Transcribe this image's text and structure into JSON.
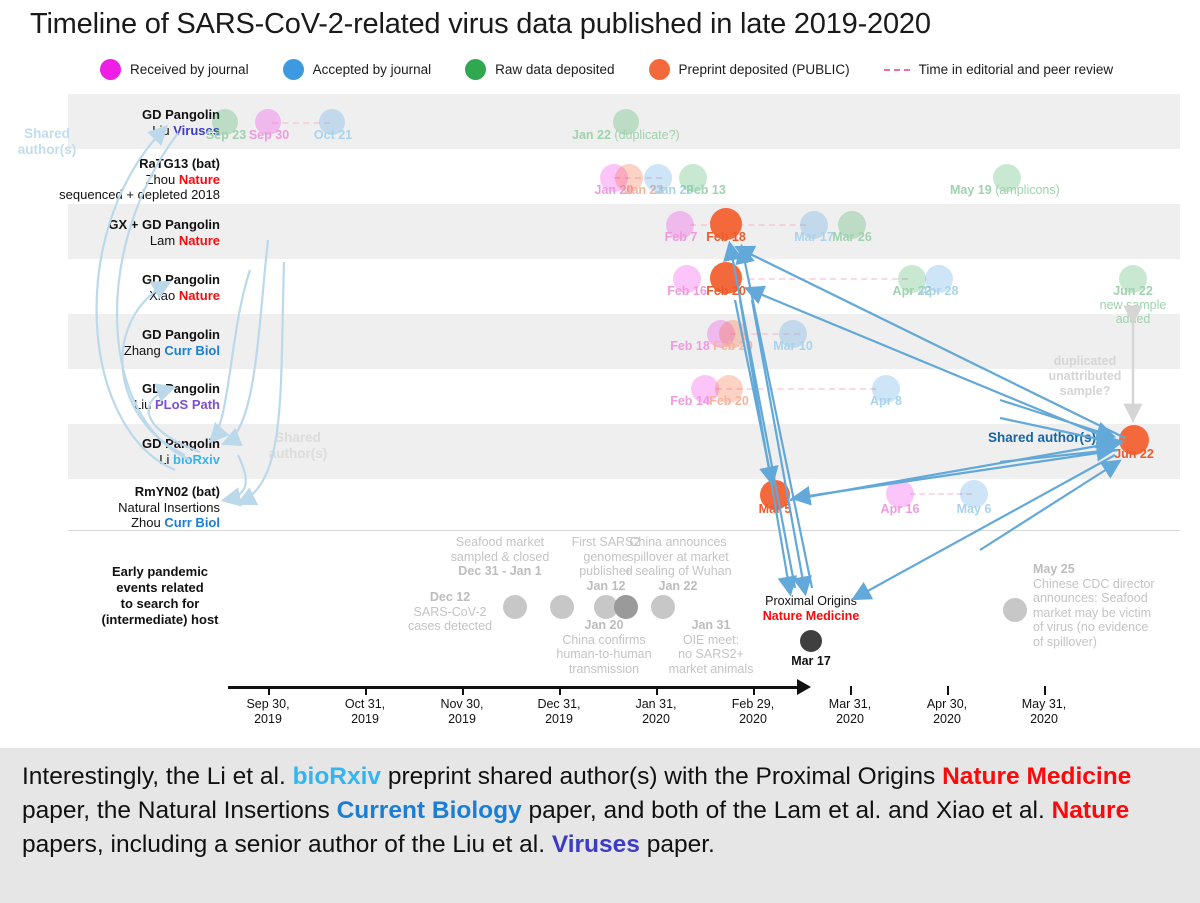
{
  "title": "Timeline of SARS-CoV-2-related virus data published in late 2019-2020",
  "legend": {
    "items": [
      {
        "label": "Received by journal",
        "color": "#ee1ee6",
        "icon": "dot-icon"
      },
      {
        "label": "Accepted by journal",
        "color": "#3d9ae0",
        "icon": "dot-icon"
      },
      {
        "label": "Raw data deposited",
        "color": "#2fa84f",
        "icon": "dot-icon"
      },
      {
        "label": "Preprint deposited (PUBLIC)",
        "color": "#f4693c",
        "icon": "dot-icon"
      },
      {
        "label": "Time in editorial and peer review",
        "color": "#f06fa8",
        "icon": "dashed-line-icon"
      }
    ]
  },
  "annotations": {
    "shared_left": "Shared\nauthor(s)",
    "shared_left_line1": "Shared",
    "shared_left_line2": "author(s)",
    "shared_mid_line1": "Shared",
    "shared_mid_line2": "author(s)",
    "shared_right": "Shared author(s)",
    "duplicated_line1": "duplicated",
    "duplicated_line2": "unattributed",
    "duplicated_line3": "sample?",
    "jun22_note_line1": "new sample",
    "jun22_note_line2": "added"
  },
  "section_label": {
    "line1": "Early pandemic",
    "line2": "events related",
    "line3": "to search for",
    "line4": "(intermediate) host"
  },
  "proximal": {
    "line1": "Proximal Origins",
    "line2": "Nature Medicine",
    "date": "Mar 17"
  },
  "rows": [
    {
      "id": "liu-viruses",
      "label_line1": "GD Pangolin",
      "label_line2_author": "Liu",
      "label_line2_journal": "Viruses",
      "journal_class": "j-viruses",
      "events": [
        {
          "date": "Sep 23",
          "type": "raw",
          "note": ""
        },
        {
          "date": "Sep 30",
          "type": "received",
          "note": ""
        },
        {
          "date": "Oct 21",
          "type": "accepted",
          "note": ""
        },
        {
          "date": "Jan 22",
          "type": "raw",
          "note": "(duplicate?)"
        }
      ]
    },
    {
      "id": "ratg13-zhou-nature",
      "label_line1": "RaTG13 (bat)",
      "label_line2_author": "Zhou",
      "label_line2_journal": "Nature",
      "label_line3": "sequenced + depleted 2018",
      "journal_class": "j-nature",
      "events": [
        {
          "date": "Jan 20",
          "type": "received",
          "note": ""
        },
        {
          "date": "Jan 23",
          "type": "preprint",
          "note": ""
        },
        {
          "date": "Jan 29",
          "type": "accepted",
          "note": ""
        },
        {
          "date": "Feb 13",
          "type": "raw",
          "note": ""
        },
        {
          "date": "May 19",
          "type": "raw",
          "note": "(amplicons)"
        }
      ]
    },
    {
      "id": "lam-nature",
      "label_line1": "GX + GD Pangolin",
      "label_line2_author": "Lam",
      "label_line2_journal": "Nature",
      "journal_class": "j-nature",
      "events": [
        {
          "date": "Feb 7",
          "type": "received",
          "note": ""
        },
        {
          "date": "Feb 18",
          "type": "preprint",
          "note": ""
        },
        {
          "date": "Mar 17",
          "type": "accepted",
          "note": ""
        },
        {
          "date": "Mar 26",
          "type": "raw",
          "note": ""
        }
      ]
    },
    {
      "id": "xiao-nature",
      "label_line1": "GD Pangolin",
      "label_line2_author": "Xiao",
      "label_line2_journal": "Nature",
      "journal_class": "j-nature",
      "events": [
        {
          "date": "Feb 16",
          "type": "received",
          "note": ""
        },
        {
          "date": "Feb 20",
          "type": "preprint",
          "note": ""
        },
        {
          "date": "Apr 22",
          "type": "raw",
          "note": ""
        },
        {
          "date": "Apr 28",
          "type": "accepted",
          "note": ""
        },
        {
          "date": "Jun 22",
          "type": "raw",
          "note": "new sample added"
        }
      ]
    },
    {
      "id": "zhang-currbiol",
      "label_line1": "GD Pangolin",
      "label_line2_author": "Zhang",
      "label_line2_journal": "Curr Biol",
      "journal_class": "j-currbiol",
      "events": [
        {
          "date": "Feb 18",
          "type": "received",
          "note": ""
        },
        {
          "date": "Feb 20",
          "type": "preprint",
          "note": ""
        },
        {
          "date": "Mar 10",
          "type": "accepted",
          "note": ""
        }
      ]
    },
    {
      "id": "liu-plospath",
      "label_line1": "GD Pangolin",
      "label_line2_author": "Liu",
      "label_line2_journal": "PLoS Path",
      "journal_class": "j-plos",
      "events": [
        {
          "date": "Feb 14",
          "type": "received",
          "note": ""
        },
        {
          "date": "Feb 20",
          "type": "preprint",
          "note": ""
        },
        {
          "date": "Apr 8",
          "type": "accepted",
          "note": ""
        }
      ]
    },
    {
      "id": "li-biorxiv",
      "label_line1": "GD Pangolin",
      "label_line2_author": "Li",
      "label_line2_journal": "bioRxiv",
      "journal_class": "j-biorxiv",
      "events": [
        {
          "date": "Jun 22",
          "type": "preprint",
          "note": ""
        }
      ]
    },
    {
      "id": "rmyn02-zhou-currbiol",
      "label_line1": "RmYN02 (bat)",
      "label_line2": "Natural Insertions",
      "label_line3_author": "Zhou",
      "label_line3_journal": "Curr Biol",
      "journal_class": "j-currbiol",
      "events": [
        {
          "date": "Mar 5",
          "type": "preprint",
          "note": ""
        },
        {
          "date": "Apr 16",
          "type": "received",
          "note": ""
        },
        {
          "date": "May 6",
          "type": "accepted",
          "note": ""
        }
      ]
    }
  ],
  "early_events": [
    {
      "date": "Dec 12",
      "desc_line1": "SARS-CoV-2",
      "desc_line2": "cases detected",
      "position": "below"
    },
    {
      "date": "Dec 31 - Jan 1",
      "desc_line1": "Seafood market",
      "desc_line2": "sampled & closed",
      "position": "above"
    },
    {
      "date": "Jan 12",
      "desc_line1": "First SARS2",
      "desc_line2": "genome",
      "desc_line3": "published",
      "position": "above"
    },
    {
      "date": "Jan 20",
      "desc_line1": "China confirms",
      "desc_line2": "human-to-human",
      "desc_line3": "transmission",
      "position": "below"
    },
    {
      "date": "Jan 22",
      "desc_line1": "China announces",
      "desc_line2": "spillover at market",
      "desc_line3": "+ sealing of Wuhan",
      "position": "above"
    },
    {
      "date": "Jan 31",
      "desc_line1": "OIE meet:",
      "desc_line2": "no SARS2+",
      "desc_line3": "market animals",
      "position": "below"
    },
    {
      "date": "May 25",
      "desc_line1": "Chinese CDC director",
      "desc_line2": "announces: Seafood",
      "desc_line3": "market may be victim",
      "desc_line4": "of virus (no evidence",
      "desc_line5": "of spillover)",
      "position": "right"
    }
  ],
  "axis": {
    "ticks": [
      {
        "line1": "Sep 30,",
        "line2": "2019"
      },
      {
        "line1": "Oct 31,",
        "line2": "2019"
      },
      {
        "line1": "Nov 30,",
        "line2": "2019"
      },
      {
        "line1": "Dec 31,",
        "line2": "2019"
      },
      {
        "line1": "Jan 31,",
        "line2": "2020"
      },
      {
        "line1": "Feb 29,",
        "line2": "2020"
      },
      {
        "line1": "Mar 31,",
        "line2": "2020"
      },
      {
        "line1": "Apr 30,",
        "line2": "2020"
      },
      {
        "line1": "May 31,",
        "line2": "2020"
      }
    ]
  },
  "caption": {
    "p1": "Interestingly, the Li et al. ",
    "biorxiv": "bioRxiv",
    "p2": " preprint shared author(s) with the Proximal Origins ",
    "natmed": "Nature Medicine",
    "p3": " paper, the Natural Insertions ",
    "currbio": "Current Biology",
    "p4": " paper, and both of the Lam et al. and Xiao et al. ",
    "nature": "Nature",
    "p5": " papers, including a senior author of the Liu et al. ",
    "viruses": "Viruses",
    "p6": " paper."
  },
  "colors": {
    "received": "#ee1ee6",
    "accepted": "#3d9ae0",
    "raw": "#2fa84f",
    "preprint": "#f4693c",
    "review_dash": "#f06fa8",
    "band": "#efefef",
    "arrow_blue": "#62a8d8",
    "grey_event": "#c7c7c7"
  }
}
